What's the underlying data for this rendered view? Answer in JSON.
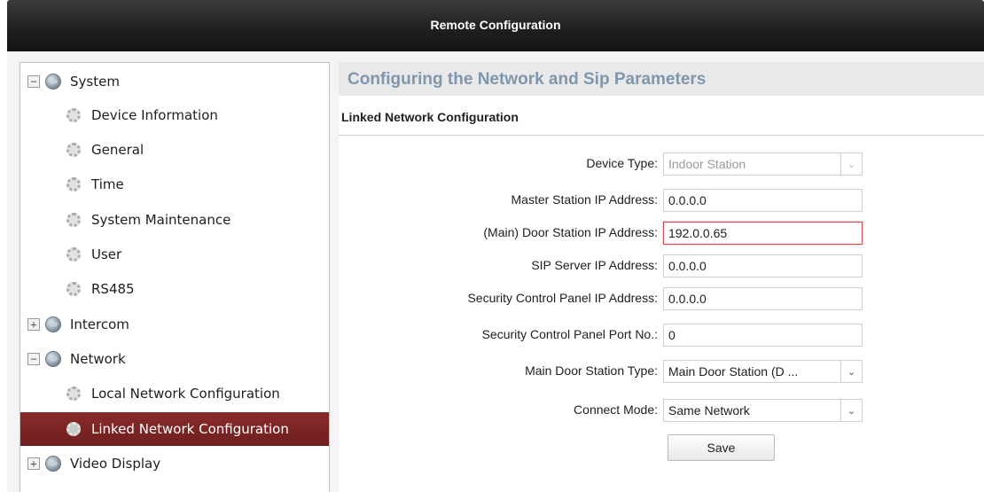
{
  "window": {
    "title": "Remote Configuration"
  },
  "sidebar": {
    "items": [
      {
        "label": "System",
        "level": "root",
        "expander": "−",
        "icon": "globe-icon"
      },
      {
        "label": "Device Information",
        "level": "child",
        "icon": "gear-icon"
      },
      {
        "label": "General",
        "level": "child",
        "icon": "gear-icon"
      },
      {
        "label": "Time",
        "level": "child",
        "icon": "gear-icon"
      },
      {
        "label": "System Maintenance",
        "level": "child",
        "icon": "gear-icon"
      },
      {
        "label": "User",
        "level": "child",
        "icon": "gear-icon"
      },
      {
        "label": "RS485",
        "level": "child",
        "icon": "gear-icon"
      },
      {
        "label": "Intercom",
        "level": "root",
        "expander": "+",
        "icon": "globe-icon"
      },
      {
        "label": "Network",
        "level": "root",
        "expander": "−",
        "icon": "globe-icon"
      },
      {
        "label": "Local Network Configuration",
        "level": "child",
        "icon": "gear-icon"
      },
      {
        "label": "Linked Network Configuration",
        "level": "child",
        "icon": "gear-icon",
        "selected": true
      },
      {
        "label": "Video Display",
        "level": "root",
        "expander": "+",
        "icon": "globe-icon"
      }
    ],
    "selected_color": "#7a2323"
  },
  "content": {
    "heading": "Configuring the Network and Sip Parameters",
    "subheading": "Linked Network Configuration",
    "fields": {
      "device_type": {
        "label": "Device Type:",
        "value": "Indoor Station"
      },
      "master_ip": {
        "label": "Master Station IP Address:",
        "value": "0.0.0.0"
      },
      "door_ip": {
        "label": "(Main) Door Station IP Address:",
        "value": "192.0.0.65"
      },
      "sip_ip": {
        "label": "SIP Server IP Address:",
        "value": "0.0.0.0"
      },
      "panel_ip": {
        "label": "Security Control Panel IP Address:",
        "value": "0.0.0.0"
      },
      "panel_port": {
        "label": "Security Control Panel Port No.:",
        "value": "0"
      },
      "door_type": {
        "label": "Main Door Station Type:",
        "value": "Main Door Station (D ..."
      },
      "connect_mode": {
        "label": "Connect Mode:",
        "value": "Same Network"
      }
    },
    "save_label": "Save",
    "heading_color": "#7f96ad",
    "active_field_border": "#d34b4b"
  }
}
